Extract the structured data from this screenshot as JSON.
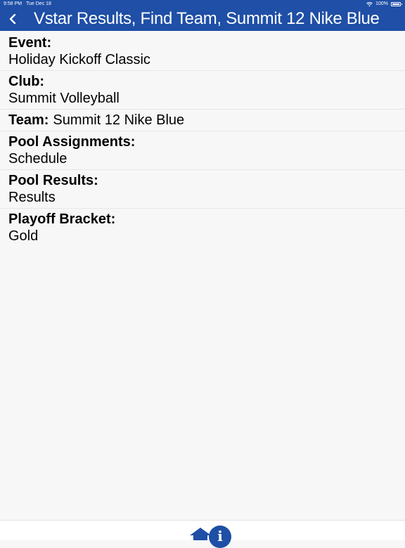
{
  "status_bar": {
    "time": "9:58 PM",
    "date": "Tue Dec 18",
    "battery": "100%"
  },
  "header": {
    "title": "Vstar Results, Find Team, Summit 12 Nike Blue",
    "back_icon": "chevron-left-icon"
  },
  "details": {
    "event_label": "Event:",
    "event_value": "Holiday Kickoff Classic",
    "club_label": "Club:",
    "club_value": "Summit Volleyball",
    "team_label": "Team:",
    "team_value": "Summit 12 Nike Blue",
    "pool_assignments_label": "Pool Assignments:",
    "pool_assignments_value": "Schedule",
    "pool_results_label": "Pool Results:",
    "pool_results_value": "Results",
    "playoff_bracket_label": "Playoff Bracket:",
    "playoff_bracket_value": "Gold"
  },
  "bottom_bar": {
    "home_icon": "home-icon",
    "info_icon": "info-icon",
    "info_glyph": "i"
  },
  "colors": {
    "header_bg": "#1f4fa6",
    "page_bg": "#f7f7f7",
    "divider": "#e6e6e6"
  }
}
